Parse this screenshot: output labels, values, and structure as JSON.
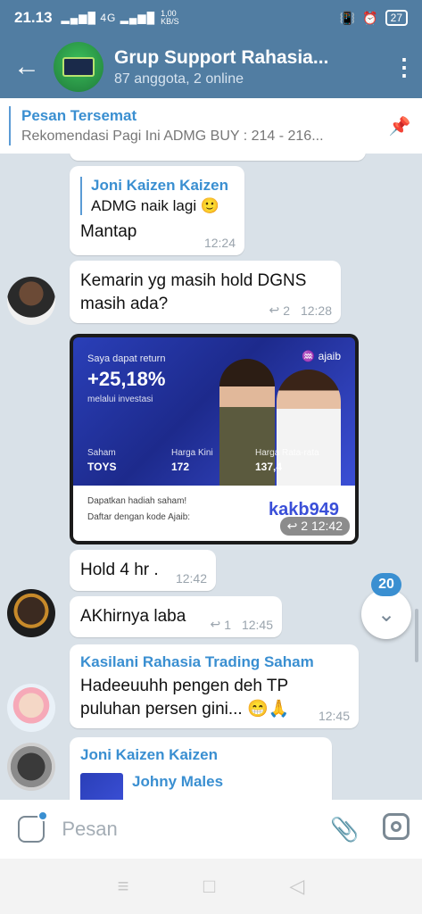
{
  "status": {
    "time": "21.13",
    "signal": "4G",
    "speed_value": "1,00",
    "speed_unit": "KB/S",
    "battery": "27"
  },
  "header": {
    "title": "Grup Support Rahasia...",
    "subtitle": "87 anggota, 2 online"
  },
  "pinned": {
    "title": "Pesan Tersemat",
    "text": "Rekomendasi Pagi Ini  ADMG BUY : 214 - 216..."
  },
  "messages": [
    {
      "quote_name": "Joni Kaizen Kaizen",
      "quote_text": "ADMG naik lagi 🙂",
      "text": "Mantap",
      "time": "12:24"
    },
    {
      "text": "Kemarin yg masih hold DGNS masih ada?",
      "replies": "2",
      "time": "12:28"
    },
    {
      "promo": {
        "line1": "Saya dapat return",
        "return": "+25,18%",
        "line3": "melalui investasi",
        "brand": "ajaib",
        "label_saham": "Saham",
        "value_saham": "TOYS",
        "label_kini": "Harga Kini",
        "value_kini": "172",
        "label_rata": "Harga Rata-rata",
        "value_rata": "137,4",
        "bottom1": "Dapatkan hadiah saham!",
        "bottom2": "Daftar dengan kode Ajaib:",
        "code": "kakb949"
      },
      "replies": "2",
      "time": "12:42"
    },
    {
      "text": "Hold 4 hr .",
      "time": "12:42"
    },
    {
      "text": "AKhirnya laba",
      "replies": "1",
      "time": "12:45"
    },
    {
      "sender": "Kasilani Rahasia Trading Saham",
      "text": "Hadeeuuhh pengen deh TP puluhan persen gini... 😁🙏",
      "time": "12:45"
    },
    {
      "sender": "Joni Kaizen Kaizen",
      "quote_name": "Johny Males"
    }
  ],
  "fab": {
    "badge": "20"
  },
  "input": {
    "placeholder": "Pesan"
  }
}
